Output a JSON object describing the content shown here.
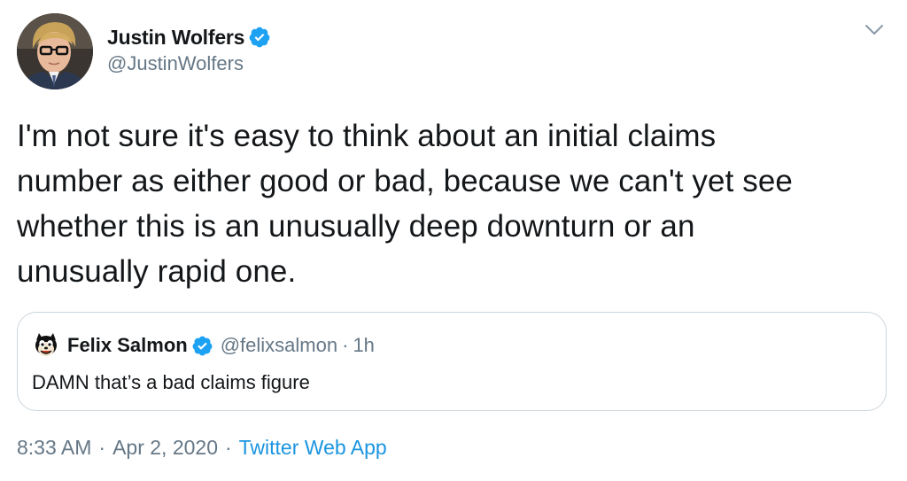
{
  "author": {
    "display_name": "Justin Wolfers",
    "handle": "@JustinWolfers",
    "verified_icon": "verified-badge-icon",
    "avatar_icon": "avatar"
  },
  "tweet": {
    "text": "I'm not sure it's easy to think about an initial claims\nnumber as either good or bad, because we can't yet see\nwhether this is an unusually deep downturn or an\nunusually rapid one."
  },
  "quoted_tweet": {
    "display_name": "Felix Salmon",
    "handle": "@felixsalmon",
    "separator": "·",
    "time": "1h",
    "text": "DAMN that’s a bad claims figure"
  },
  "meta": {
    "time": "8:33 AM",
    "separator1": "·",
    "date": "Apr 2, 2020",
    "separator2": "·",
    "source": "Twitter Web App"
  },
  "colors": {
    "text": "#14171a",
    "secondary": "#657786",
    "link": "#1b95e0",
    "verified": "#1da1f2",
    "border": "#ccd6dd"
  }
}
